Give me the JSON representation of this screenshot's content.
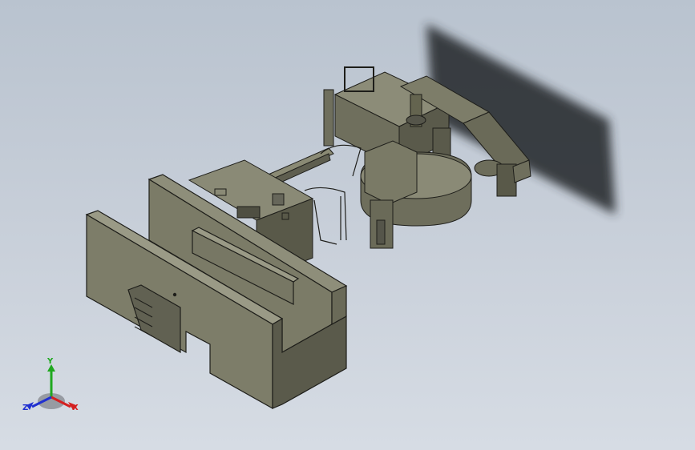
{
  "viewport": {
    "background_top": "#b9c3cf",
    "background_bottom": "#d6dce4"
  },
  "model": {
    "body_color": "#7a7a66",
    "shade_color": "#5e5e4f",
    "edge_color": "#1e1e1a",
    "shadow_color": "#2b2e33"
  },
  "triad": {
    "x_label": "X",
    "y_label": "Y",
    "z_label": "Z",
    "x_color": "#d42020",
    "y_color": "#1fa81f",
    "z_color": "#2030d0"
  }
}
